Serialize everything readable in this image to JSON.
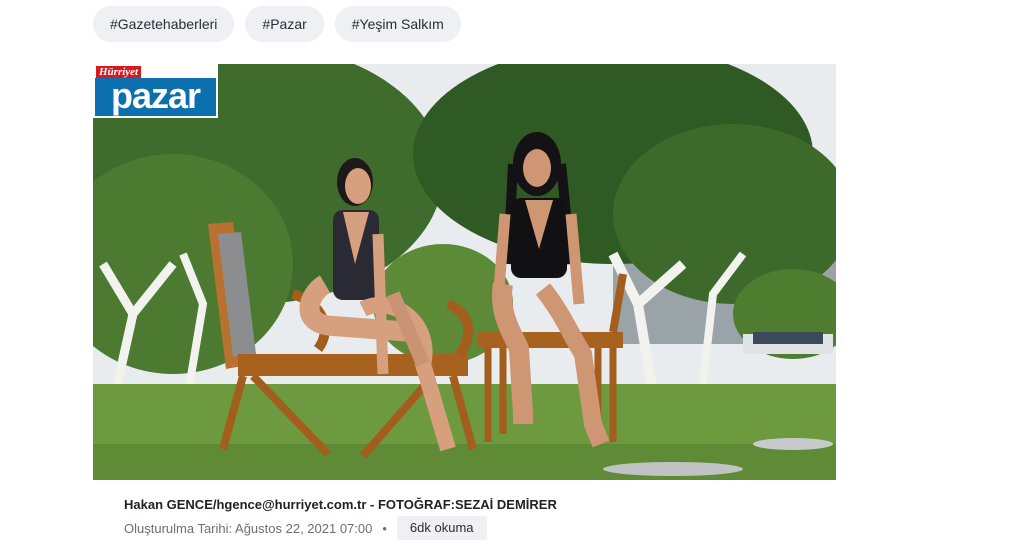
{
  "tags": [
    "#Gazetehaberleri",
    "#Pazar",
    "#Yeşim Salkım"
  ],
  "logo": {
    "top": "Hürriyet",
    "main": "pazar"
  },
  "byline": "Hakan GENCE/hgence@hurriyet.com.tr - FOTOĞRAF:SEZAİ DEMİRER",
  "meta": {
    "date": "Oluşturulma Tarihi: Ağustos 22, 2021 07:00",
    "separator": "•",
    "read_time": "6dk okuma"
  },
  "colors": {
    "logo_red": "#d71920",
    "logo_blue": "#0c6fae",
    "chip_bg": "#eef0f3"
  }
}
